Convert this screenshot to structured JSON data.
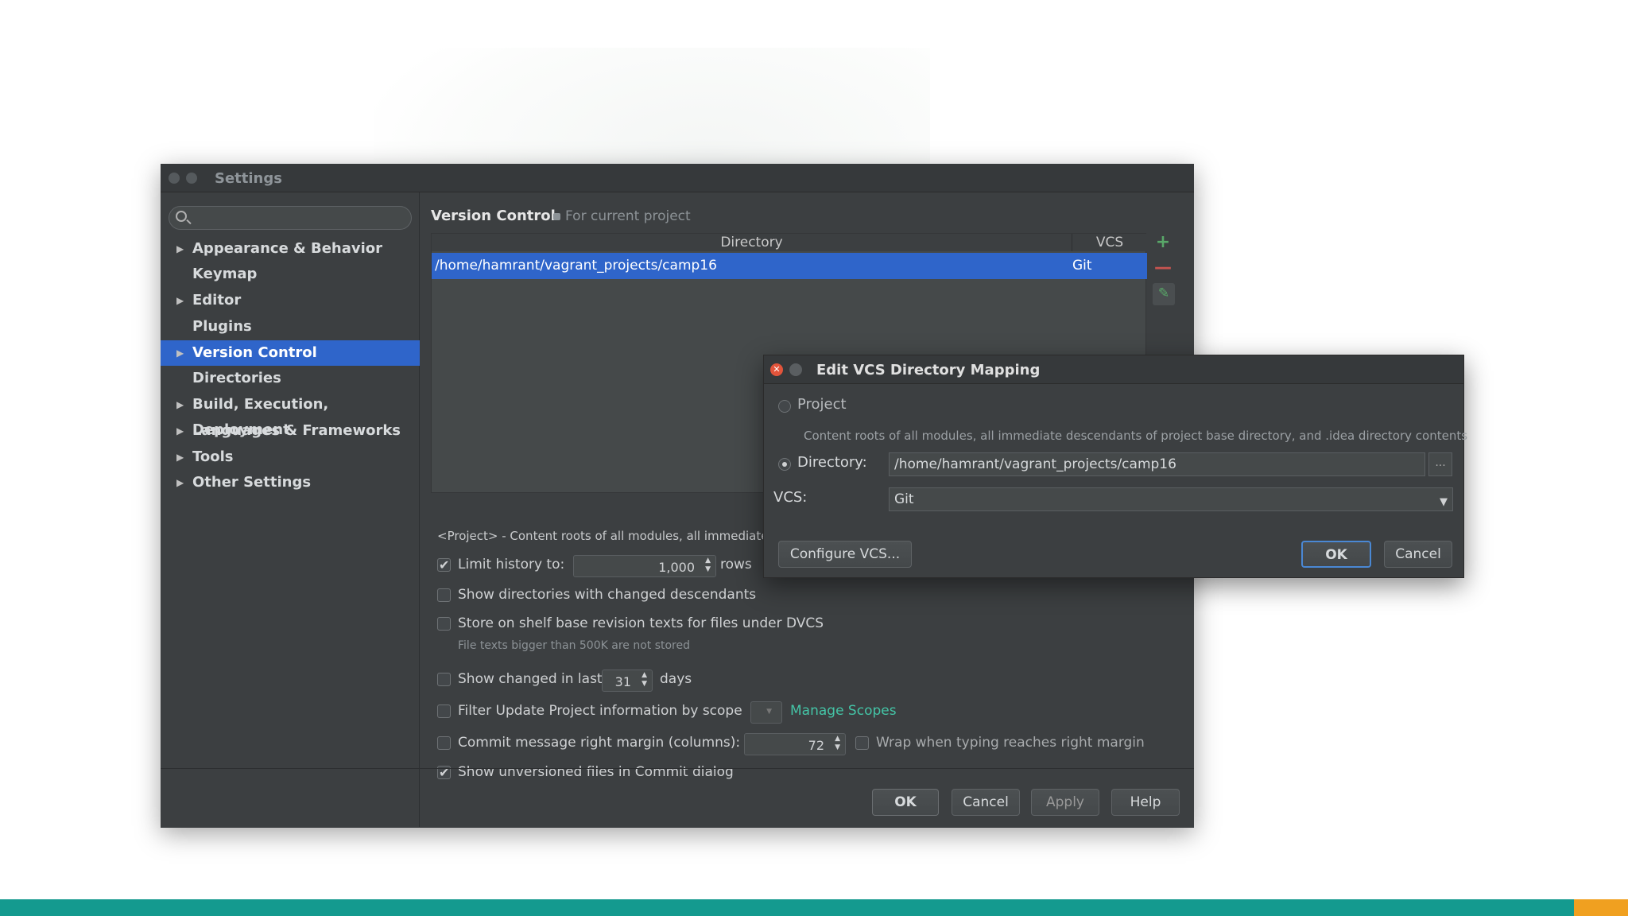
{
  "settings": {
    "title": "Settings",
    "sidebar": [
      {
        "label": "Appearance & Behavior",
        "expandable": true
      },
      {
        "label": "Keymap",
        "expandable": false
      },
      {
        "label": "Editor",
        "expandable": true
      },
      {
        "label": "Plugins",
        "expandable": false
      },
      {
        "label": "Version Control",
        "expandable": true,
        "selected": true
      },
      {
        "label": "Directories",
        "expandable": false
      },
      {
        "label": "Build, Execution, Deployment",
        "expandable": true
      },
      {
        "label": "Languages & Frameworks",
        "expandable": true
      },
      {
        "label": "Tools",
        "expandable": true
      },
      {
        "label": "Other Settings",
        "expandable": true
      }
    ],
    "content": {
      "title": "Version Control",
      "scope": "For current project",
      "table": {
        "col_directory": "Directory",
        "col_vcs": "VCS",
        "rows": [
          {
            "directory": "/home/hamrant/vagrant_projects/camp16",
            "vcs": "Git"
          }
        ]
      },
      "project_note": "<Project> - Content roots of all modules, all immediate d",
      "limit_history": {
        "label": "Limit history to:",
        "value": "1,000",
        "suffix": "rows",
        "checked": true
      },
      "show_dirs": {
        "label": "Show directories with changed descendants",
        "checked": false
      },
      "store_shelf": {
        "label": "Store on shelf base revision texts for files under DVCS",
        "checked": false
      },
      "store_shelf_hint": "File texts bigger than 500K are not stored",
      "show_changed": {
        "label": "Show changed in last",
        "value": "31",
        "suffix": "days",
        "checked": false
      },
      "filter_update": {
        "label": "Filter Update Project information by scope",
        "link": "Manage Scopes",
        "checked": false
      },
      "commit_margin": {
        "label": "Commit message right margin (columns):",
        "value": "72",
        "checked": false
      },
      "wrap_typing": {
        "label": "Wrap when typing reaches right margin",
        "checked": false
      },
      "show_unversioned": {
        "label": "Show unversioned files in Commit dialog",
        "checked": true
      }
    },
    "buttons": {
      "ok": "OK",
      "cancel": "Cancel",
      "apply": "Apply",
      "help": "Help"
    }
  },
  "dialog": {
    "title": "Edit VCS Directory Mapping",
    "project_label": "Project",
    "project_desc": "Content roots of all modules, all immediate descendants of project base directory, and .idea directory contents",
    "directory_label": "Directory:",
    "directory_value": "/home/hamrant/vagrant_projects/camp16",
    "browse_label": "...",
    "vcs_label": "VCS:",
    "vcs_value": "Git",
    "configure_button": "Configure VCS...",
    "ok": "OK",
    "cancel": "Cancel"
  },
  "colors": {
    "accent": "#2f65ca",
    "add_icon": "#59a869",
    "remove_icon": "#c75450",
    "link": "#44c4a6",
    "bottom_bar": "#149a8f"
  }
}
